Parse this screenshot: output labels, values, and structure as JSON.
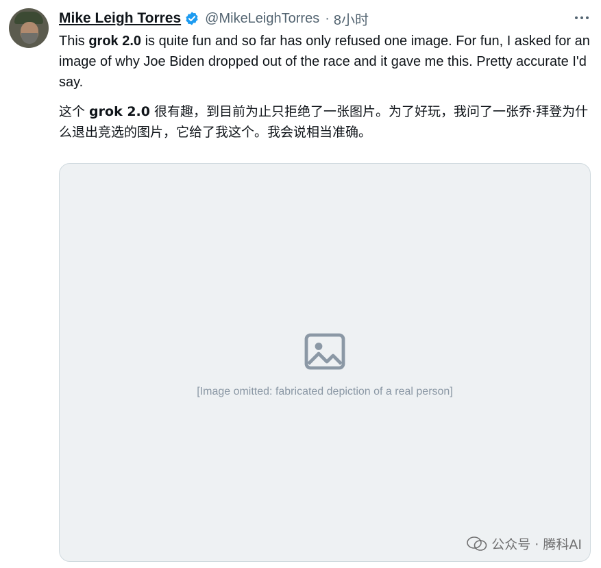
{
  "tweet": {
    "author_name": "Mike Leigh Torres",
    "handle": "@MikeLeighTorres",
    "separator": "·",
    "time": "8小时",
    "verified_color": "#1d9bf0",
    "text_en_1": "This ",
    "text_en_bold": "grok 2.0",
    "text_en_2": " is quite fun and so far has only refused one image. For fun, I asked for an image of why Joe Biden dropped out of the race and it gave me this. Pretty accurate I'd say.",
    "text_zh_1": "这个 ",
    "text_zh_bold": "grok 2.0",
    "text_zh_2": " 很有趣，到目前为止只拒绝了一张图片。为了好玩，我问了一张乔·拜登为什么退出竞选的图片，它给了我这个。我会说相当准确。"
  },
  "media": {
    "caption": "[Image omitted: fabricated depiction of a real person]",
    "watermark": "公众号 · 腾科AI"
  }
}
